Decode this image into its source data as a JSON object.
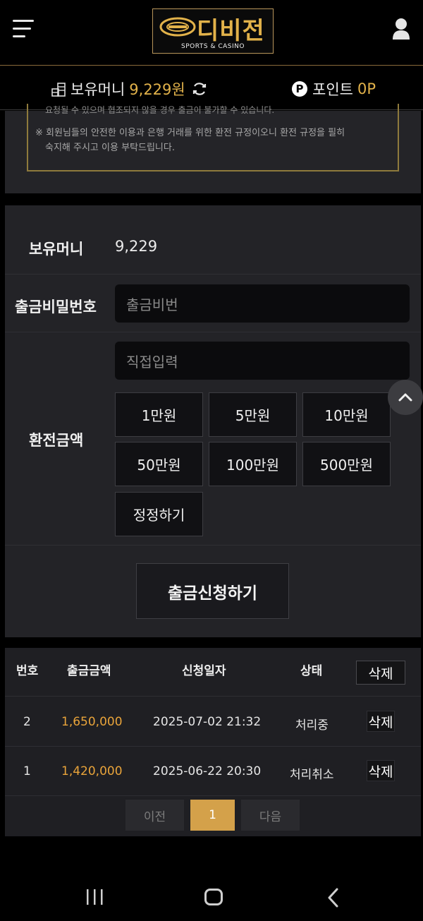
{
  "header": {
    "logo_text": "디비전",
    "logo_sub": "SPORTS & CASINO"
  },
  "balance_bar": {
    "money_label": "보유머니",
    "money_value": "9,229원",
    "point_icon": "P",
    "point_label": "포인트",
    "point_value": "0P"
  },
  "notice": {
    "line0": "요청될 수 있으며 협조되지 않을 경우 출금이 불가할 수 있습니다.",
    "line1": "※ 회원님들의 안전한 이용과 은행 거래를 위한 환전 규정이오니 환전 규정을 필히",
    "line2": "숙지해 주시고 이용 부탁드립니다."
  },
  "form": {
    "money_label": "보유머니",
    "money_value": "9,229",
    "password_label": "출금비밀번호",
    "password_placeholder": "출금비번",
    "amount_label": "환전금액",
    "amount_placeholder": "직접입력",
    "amount_buttons": [
      "1만원",
      "5만원",
      "10만원",
      "50만원",
      "100만원",
      "500만원"
    ],
    "reset_label": "정정하기",
    "submit_label": "출금신청하기"
  },
  "history": {
    "columns": [
      "번호",
      "출금금액",
      "신청일자",
      "상태"
    ],
    "delete_all_label": "삭제",
    "rows": [
      {
        "no": "2",
        "amount": "1,650,000",
        "date": "2025-07-02 21:32",
        "status": "처리중",
        "delete_label": "삭제"
      },
      {
        "no": "1",
        "amount": "1,420,000",
        "date": "2025-06-22 20:30",
        "status": "처리취소",
        "delete_label": "삭제"
      }
    ],
    "pagination": {
      "prev_label": "이전",
      "current_page": "1",
      "next_label": "다음"
    }
  },
  "colors": {
    "accent_gold": "#e2b24a",
    "amount_orange": "#e9a43a",
    "page_active": "#d4a14a"
  },
  "icons": [
    "menu-icon",
    "user-icon",
    "coins-icon",
    "refresh-icon",
    "point-icon",
    "chevron-up-icon",
    "nav-recent-apps-icon",
    "nav-home-icon",
    "nav-back-icon"
  ]
}
